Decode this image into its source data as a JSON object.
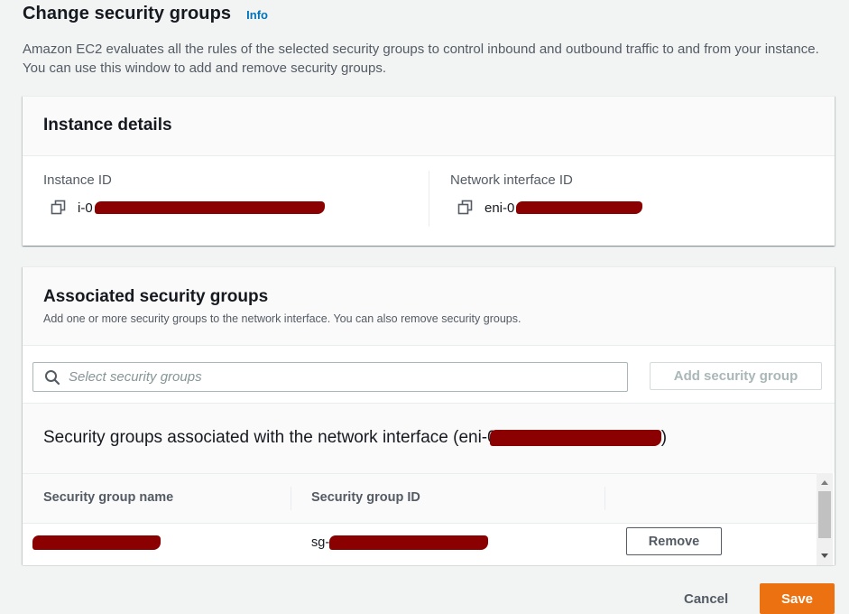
{
  "page": {
    "title": "Change security groups",
    "info_link": "Info",
    "description": "Amazon EC2 evaluates all the rules of the selected security groups to control inbound and outbound traffic to and from your instance. You can use this window to add and remove security groups."
  },
  "instance_details": {
    "heading": "Instance details",
    "instance_id_label": "Instance ID",
    "instance_id_value": "i-0",
    "network_interface_label": "Network interface ID",
    "network_interface_value": "eni-0"
  },
  "associated": {
    "heading": "Associated security groups",
    "description": "Add one or more security groups to the network interface. You can also remove security groups.",
    "search_placeholder": "Select security groups",
    "add_button": "Add security group",
    "table_heading_prefix": "Security groups associated with the network interface (eni-0",
    "table_heading_suffix": ")",
    "columns": [
      "Security group name",
      "Security group ID"
    ],
    "rows": [
      {
        "name": "",
        "id": "sg-"
      }
    ],
    "remove_button": "Remove"
  },
  "footer": {
    "cancel": "Cancel",
    "save": "Save"
  },
  "icons": {
    "copy": "copy-icon",
    "search": "search-icon"
  },
  "colors": {
    "primary": "#ec7211",
    "link": "#0073bb",
    "redaction": "#8b0000"
  }
}
